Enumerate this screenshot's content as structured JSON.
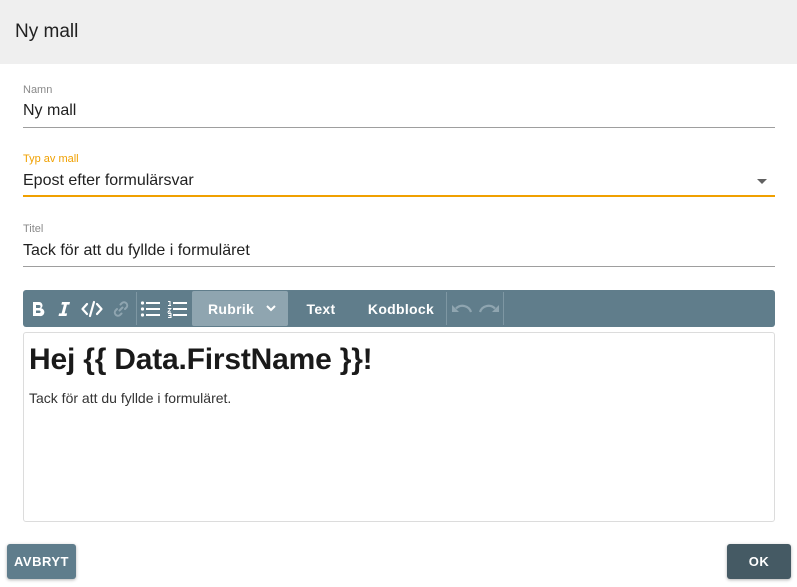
{
  "dialog": {
    "title": "Ny mall"
  },
  "form": {
    "name": {
      "label": "Namn",
      "value": "Ny mall"
    },
    "type": {
      "label": "Typ av mall",
      "value": "Epost efter formulärsvar"
    },
    "title": {
      "label": "Titel",
      "value": "Tack för att du fyllde i formuläret"
    }
  },
  "toolbar": {
    "block_format": "Rubrik",
    "text_label": "Text",
    "codeblock_label": "Kodblock"
  },
  "editor": {
    "heading": "Hej {{ Data.FirstName }}!",
    "paragraph": "Tack för att du fyllde i formuläret."
  },
  "actions": {
    "cancel_label": "AVBRYT",
    "ok_label": "OK"
  },
  "colors": {
    "accent": "#f0a000",
    "toolbar": "#607d8b",
    "ok_button": "#455a64"
  }
}
